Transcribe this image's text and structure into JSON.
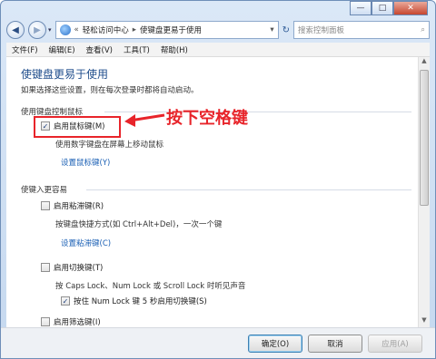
{
  "caption": {
    "min": "—",
    "max": "□",
    "close": "✕"
  },
  "address": {
    "segments": [
      "«",
      "轻松访问中心",
      "▸",
      "使键盘更易于使用",
      "▾"
    ],
    "refresh": "↻",
    "search_placeholder": "搜索控制面板",
    "search_icon": "⌕"
  },
  "menu": [
    "文件(F)",
    "编辑(E)",
    "查看(V)",
    "工具(T)",
    "帮助(H)"
  ],
  "content": {
    "title": "使键盘更易于使用",
    "subtitle": "如果选择这些设置，则在每次登录时都将自动启动。",
    "section1": "使用键盘控制鼠标",
    "mousekeys_label": "启用鼠标键(M)",
    "mousekeys_checked": "✓",
    "mousekeys_desc": "使用数字键盘在屏幕上移动鼠标",
    "mousekeys_link": "设置鼠标键(Y)",
    "section2": "使键入更容易",
    "sticky_label": "启用粘滞键(R)",
    "sticky_desc": "按键盘快捷方式(如 Ctrl+Alt+Del)，一次一个键",
    "sticky_link": "设置粘滞键(C)",
    "toggle_label": "启用切换键(T)",
    "toggle_desc": "按 Caps Lock、Num Lock 或 Scroll Lock 时听见声音",
    "toggle_sub_label": "按住 Num Lock 键 5 秒启用切换键(S)",
    "toggle_sub_checked": "✓",
    "filter_label": "启用筛选键(I)",
    "annotation": "按下空格键"
  },
  "footer": {
    "ok": "确定(O)",
    "cancel": "取消",
    "apply": "应用(A)"
  },
  "colors": {
    "accent": "#1f4d8c",
    "link": "#1a5fb4",
    "annotation": "#e8242a"
  }
}
